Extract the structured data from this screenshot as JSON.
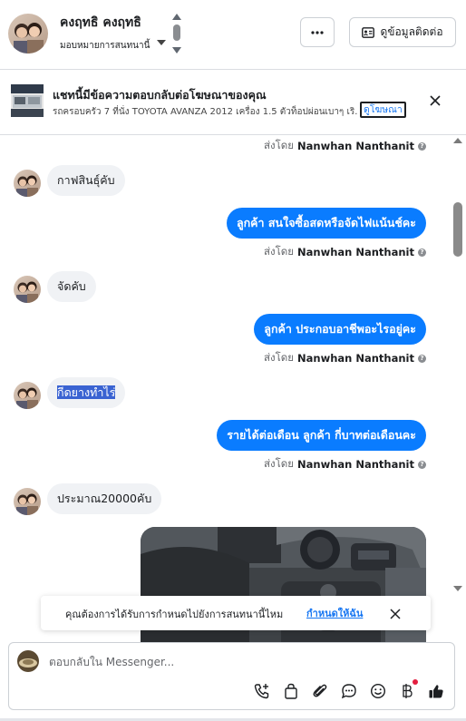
{
  "header": {
    "contact_name": "คงฤทธิ คงฤทธิ",
    "assign_label": "มอบหมายการสนทนานี้",
    "more_label": "···",
    "view_contact_label": "ดูข้อมูลติดต่อ"
  },
  "ad_banner": {
    "title": "แชทนี้มีข้อความตอบกลับต่อโฆษณาของคุณ",
    "subtitle": "รถครอบครัว 7 ที่นั่ง TOYOTA AVANZA 2012 เครื่อง 1.5 ตัวท็อปผ่อนเบาๆ เริ...",
    "link_label": "ดูโฆษณา"
  },
  "messages": [
    {
      "type": "sent_by",
      "prefix": "ส่งโดย",
      "name": "Nanwhan Nanthanit"
    },
    {
      "type": "in",
      "text": "กาฟสินธุ์คับ"
    },
    {
      "type": "out",
      "text": "ลูกค้า สนใจซื้อสดหรือจัดไฟแน้นช์คะ"
    },
    {
      "type": "sent_by",
      "prefix": "ส่งโดย",
      "name": "Nanwhan Nanthanit"
    },
    {
      "type": "in",
      "text": "จัดคับ"
    },
    {
      "type": "out",
      "text": "ลูกค้า ประกอบอาชีพอะไรอยู่คะ"
    },
    {
      "type": "sent_by",
      "prefix": "ส่งโดย",
      "name": "Nanwhan Nanthanit"
    },
    {
      "type": "in",
      "text": "กีดยางทำไร่"
    },
    {
      "type": "out",
      "text": "รายได้ต่อเดือน  ลูกค้า กี่บาทต่อเดือนคะ"
    },
    {
      "type": "sent_by",
      "prefix": "ส่งโดย",
      "name": "Nanwhan Nanthanit"
    },
    {
      "type": "in",
      "text": "ประมาณ20000คับ"
    }
  ],
  "assign_toast": {
    "text": "คุณต้องการได้รับการกำหนดไปยังการสนทนานี้ไหม",
    "link_label": "กำหนดให้ฉัน"
  },
  "composer": {
    "placeholder": "ตอบกลับใน Messenger..."
  },
  "icons": {
    "call": "phone-plus-icon",
    "shop": "shopping-bag-icon",
    "attach": "paperclip-icon",
    "saved_reply": "chat-bubble-icon",
    "emoji": "emoji-icon",
    "payment": "baht-icon",
    "like": "thumbs-up-icon"
  },
  "colors": {
    "outgoing_bubble": "#0a7cff",
    "incoming_bubble": "#f0f2f5",
    "link": "#1877f2",
    "selection_highlight": "#3a63d2"
  }
}
